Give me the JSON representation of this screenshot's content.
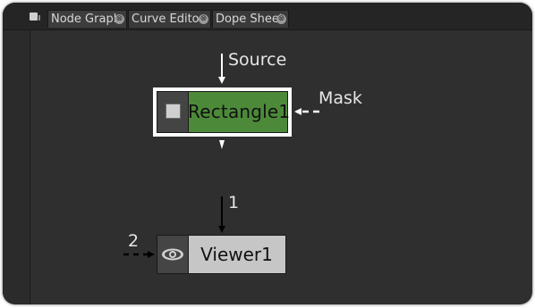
{
  "tabs": [
    {
      "label": "Node Graph"
    },
    {
      "label": "Curve Editor"
    },
    {
      "label": "Dope Sheet"
    }
  ],
  "close_glyph": "⊗",
  "nodes": {
    "rectangle": {
      "label": "Rectangle1",
      "color": "#4c8a3a"
    },
    "viewer": {
      "label": "Viewer1",
      "color": "#c6c6c6"
    }
  },
  "inputs": {
    "source": "Source",
    "mask": "Mask",
    "viewer_input_1": "1",
    "viewer_input_2": "2"
  },
  "icons": {
    "rectangle_node": "square-icon",
    "viewer_node": "eye-icon",
    "tab_menu": "pane-menu-icon"
  }
}
